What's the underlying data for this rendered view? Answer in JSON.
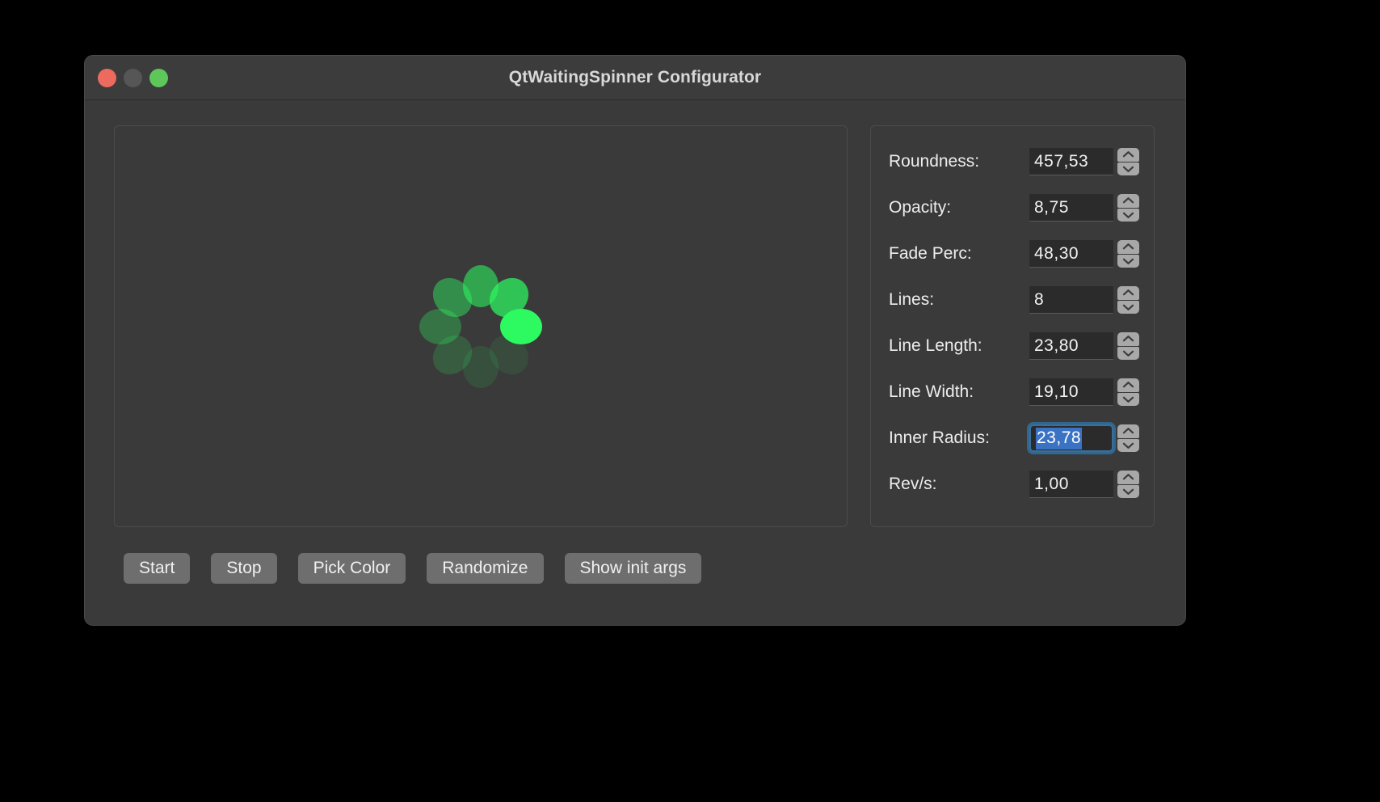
{
  "window": {
    "title": "QtWaitingSpinner Configurator",
    "traffic_lights": [
      {
        "name": "close",
        "color": "#ec6a5e"
      },
      {
        "name": "minimize",
        "color": "#565656"
      },
      {
        "name": "zoom",
        "color": "#5ec75a"
      }
    ]
  },
  "preview": {
    "spinner": {
      "lines": 8,
      "base_color": "#2dfa61",
      "radius_px": 50,
      "dot_width": 44,
      "dot_height": 52,
      "dot_opacities": [
        1.0,
        0.72,
        0.56,
        0.44,
        0.3,
        0.18,
        0.12,
        0.09
      ]
    }
  },
  "settings": {
    "fields": [
      {
        "label": "Roundness:",
        "value": "457,53",
        "focused": false
      },
      {
        "label": "Opacity:",
        "value": "8,75",
        "focused": false
      },
      {
        "label": "Fade Perc:",
        "value": "48,30",
        "focused": false
      },
      {
        "label": "Lines:",
        "value": "8",
        "focused": false
      },
      {
        "label": "Line Length:",
        "value": "23,80",
        "focused": false
      },
      {
        "label": "Line Width:",
        "value": "19,10",
        "focused": false
      },
      {
        "label": "Inner Radius:",
        "value": "23,78",
        "focused": true
      },
      {
        "label": "Rev/s:",
        "value": "1,00",
        "focused": false
      }
    ]
  },
  "actions": {
    "buttons": [
      {
        "label": "Start"
      },
      {
        "label": "Stop"
      },
      {
        "label": "Pick Color"
      },
      {
        "label": "Randomize"
      },
      {
        "label": "Show init args"
      }
    ]
  },
  "colors": {
    "desktop": "#000000",
    "window_bg": "#3a3a3a",
    "titlebar_bg": "#3c3c3c",
    "frame_border": "#4b4b4b",
    "field_bg": "#2b2b2b",
    "button_bg": "#6e6e6e",
    "focus_ring": "#3a6f9a",
    "selection": "#3a73c4",
    "text": "#ededed"
  }
}
